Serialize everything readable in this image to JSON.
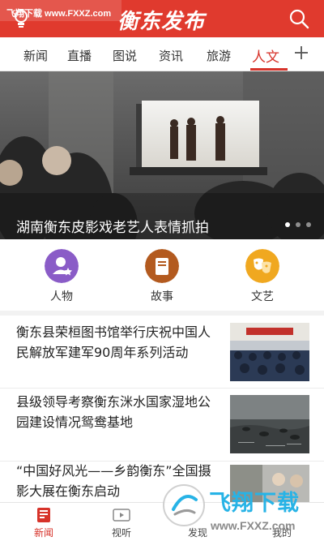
{
  "watermark": {
    "text": "飞翔下载 www.FXXZ.com"
  },
  "header": {
    "title": "衡东发布"
  },
  "tabs": [
    {
      "label": "新闻"
    },
    {
      "label": "直播"
    },
    {
      "label": "图说"
    },
    {
      "label": "资讯"
    },
    {
      "label": "旅游"
    },
    {
      "label": "人文"
    }
  ],
  "active_tab": "人文",
  "banner": {
    "caption": "湖南衡东皮影戏老艺人表情抓拍",
    "slide_count": 3,
    "active_slide": 1
  },
  "categories": [
    {
      "label": "人物",
      "icon": "person-icon",
      "color": "#8a5cc7"
    },
    {
      "label": "故事",
      "icon": "book-icon",
      "color": "#b35a1f"
    },
    {
      "label": "文艺",
      "icon": "mask-icon",
      "color": "#f0a820"
    }
  ],
  "news": [
    {
      "title": "衡东县荣桓图书馆举行庆祝中国人民解放军建军90周年系列活动"
    },
    {
      "title": "县级领导考察衡东洣水国家湿地公园建设情况鸳鸯基地"
    },
    {
      "title": "“中国好风光——乡韵衡东”全国摄影大展在衡东启动"
    }
  ],
  "bottom_nav": [
    {
      "label": "新闻",
      "icon": "news-icon"
    },
    {
      "label": "视听",
      "icon": "video-icon"
    },
    {
      "label": "发现",
      "icon": "discover-icon"
    },
    {
      "label": "",
      "icon": ""
    },
    {
      "label": "我的",
      "icon": "profile-icon"
    }
  ],
  "overlay_watermark": {
    "big": "飞翔下载",
    "url": "www.FXXZ.com"
  },
  "colors": {
    "brand": "#e03a2e",
    "accent": "#d7332a"
  }
}
